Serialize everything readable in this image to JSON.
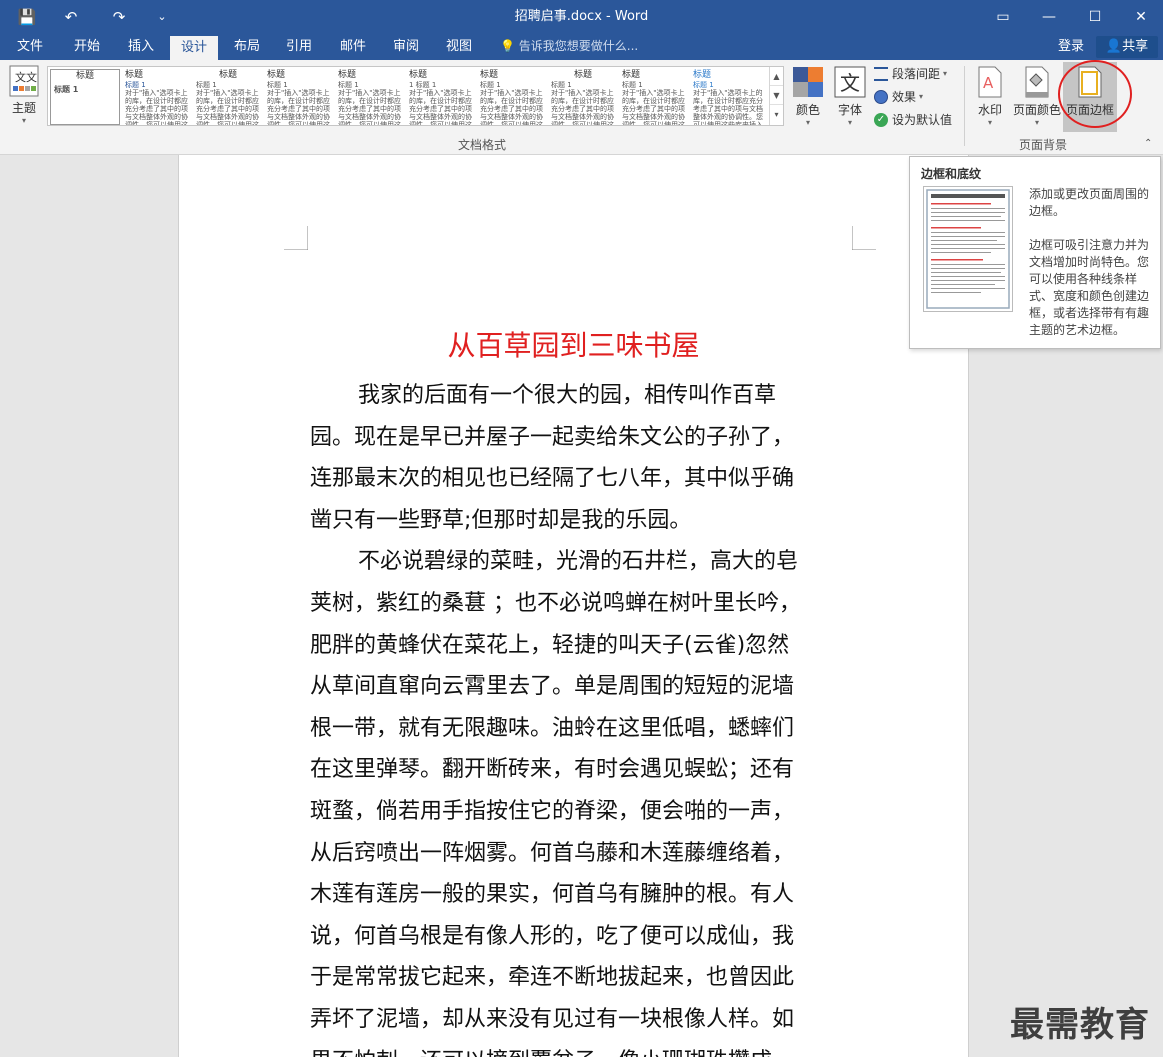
{
  "window": {
    "title": "招聘启事.docx - Word",
    "buttons": {
      "restore_ribbon": "▭",
      "minimize": "—",
      "maximize": "☐",
      "close": "✕"
    }
  },
  "quick_access": {
    "save": "💾",
    "undo": "↶",
    "redo": "↷",
    "customize": "⌄"
  },
  "tabs": [
    "文件",
    "开始",
    "插入",
    "设计",
    "布局",
    "引用",
    "邮件",
    "审阅",
    "视图"
  ],
  "active_tab": "设计",
  "tell_me": "💡 告诉我您想要做什么...",
  "account": {
    "login": "登录",
    "share": "共享"
  },
  "ribbon": {
    "theme_label": "主题",
    "gallery_items": [
      {
        "heading": "标题",
        "sub": "标题 1",
        "text": ""
      },
      {
        "heading": "标题",
        "sub": "标题 1",
        "text": "对于\"插入\"选项卡上的库，在设计时都应充分考虑了其中的项与文档整体外观的协调性。您可以使用这些库来插入表格、页眉、页脚、列表、封面以及其他文档构建基块。"
      },
      {
        "heading": "标题",
        "sub": "标题 1",
        "text": "对于\"插入\"选项卡上的库，在设计时都应充分考虑了其中的项与文档整体外观的协调性。您可以使用这些库来插入表格、页眉、页脚、列表、封面以及其他文档构建基块。"
      },
      {
        "heading": "标题",
        "sub": "标题 1",
        "text": "对于\"插入\"选项卡上的库，在设计时都应充分考虑了其中的项与文档整体外观的协调性。您可以使用这些库来插入表格、页眉、页脚、列表、封面以及其他文档构建基块。"
      },
      {
        "heading": "标题",
        "sub": "标题 1",
        "text": "对于\"插入\"选项卡上的库，在设计时都应充分考虑了其中的项与文档整体外观的协调性。您可以使用这些库来插入表格、页眉、页脚、列表、封面以及其他文档构建基块。"
      },
      {
        "heading": "标题",
        "sub": "1  标题 1",
        "text": "对于\"插入\"选项卡上的库，在设计时都应充分考虑了其中的项与文档整体外观的协调性。您可以使用这些库来插入表格、页眉、页脚、列表、封面以及其他文档构建基块。"
      },
      {
        "heading": "标题",
        "sub": "标题 1",
        "text": "对于\"插入\"选项卡上的库，在设计时都应充分考虑了其中的项与文档整体外观的协调性。您可以使用这些库来插入表格、页眉、页脚、列表、封面以及其他文档构建基块。"
      },
      {
        "heading": "标题",
        "sub": "标题 1",
        "text": "对于\"插入\"选项卡上的库，在设计时都应充分考虑了其中的项与文档整体外观的协调性。您可以使用这些库来插入表格、页眉、页脚、列表、封面以及其他文档构建基块。"
      },
      {
        "heading": "标题",
        "sub": "标题 1",
        "text": "对于\"插入\"选项卡上的库，在设计时都应充分考虑了其中的项与文档整体外观的协调性。您可以使用这些库来插入表格、页眉、页脚、列表、封面以及其他文档构建基块。"
      },
      {
        "heading": "标题",
        "sub": "标题 1",
        "text": "对于\"插入\"选项卡上的库，在设计时都应充分考虑了其中的项与文档整体外观的协调性。您可以使用这些库来插入表格、页眉、页脚、列表、封面以及其他文档构建基块。"
      }
    ],
    "doc_format_label": "文档格式",
    "colors_label": "颜色",
    "fonts_label": "字体",
    "paragraph_spacing": "段落间距",
    "effects": "效果",
    "set_default": "设为默认值",
    "watermark_label": "水印",
    "page_color_label": "页面颜色",
    "page_borders_label": "页面边框",
    "page_background_label": "页面背景"
  },
  "tooltip": {
    "title": "边框和底纹",
    "line1": "添加或更改页面周围的边框。",
    "line2": "边框可吸引注意力并为文档增加时尚特色。您可以使用各种线条样式、宽度和颜色创建边框，或者选择带有有趣主题的艺术边框。"
  },
  "document": {
    "title": "从百草园到三味书屋",
    "lines": [
      "我家的后面有一个很大的园，相传叫作百草",
      "园。现在是早已并屋子一起卖给朱文公的子孙了，",
      "连那最末次的相见也已经隔了七八年，其中似乎确",
      "凿只有一些野草;但那时却是我的乐园。",
      "不必说碧绿的菜畦，光滑的石井栏，高大的皂",
      "荚树，紫红的桑葚 ；也不必说鸣蝉在树叶里长吟，",
      "肥胖的黄蜂伏在菜花上，轻捷的叫天子(云雀)忽然",
      "从草间直窜向云霄里去了。单是周围的短短的泥墙",
      "根一带，就有无限趣味。油蛉在这里低唱，蟋蟀们",
      "在这里弹琴。翻开断砖来，有时会遇见蜈蚣；还有",
      "斑蝥，倘若用手指按住它的脊梁，便会啪的一声，",
      "从后窍喷出一阵烟雾。何首乌藤和木莲藤缠络着，",
      "木莲有莲房一般的果实，何首乌有臃肿的根。有人",
      "说，何首乌根是有像人形的，吃了便可以成仙，我",
      "于是常常拔它起来，牵连不断地拔起来，也曾因此",
      "弄坏了泥墙，却从来没有见过有一块根像人样。如",
      "果不怕刺，还可以摘到覆盆子，像小珊瑚珠攒成"
    ]
  },
  "watermark_text": "最需教育",
  "colors": {
    "brand": "#2b579a",
    "title_red": "#e02020"
  }
}
